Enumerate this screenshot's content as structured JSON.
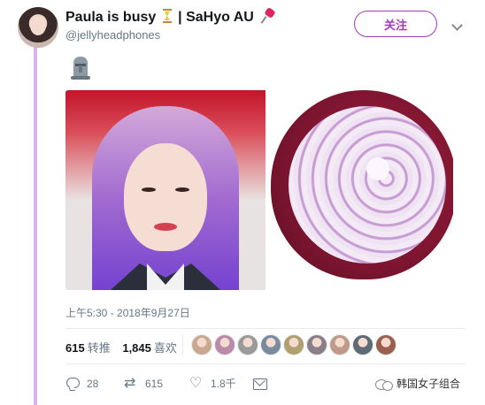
{
  "tweet": {
    "display_name_part1": "Paula is busy",
    "display_name_part2": "| SaHyo AU",
    "handle": "@jellyheadphones",
    "follow_label": "关注",
    "timestamp": "上午5:30 - 2018年9月27日",
    "retweets_count": "615",
    "retweets_label": "转推",
    "likes_count": "1,845",
    "likes_label": "喜欢",
    "icons": [
      "hourglass-icon",
      "pin-icon",
      "moai-icon",
      "reply-icon",
      "retweet-icon",
      "like-icon",
      "message-icon",
      "chevron-down-icon"
    ]
  },
  "likers": [
    {
      "color": "#caa88f"
    },
    {
      "color": "#b98ba8"
    },
    {
      "color": "#9a9a9a"
    },
    {
      "color": "#7a8aa0"
    },
    {
      "color": "#b0a070"
    },
    {
      "color": "#8a7f88"
    },
    {
      "color": "#c09a88"
    },
    {
      "color": "#5e6a74"
    },
    {
      "color": "#9b5f50"
    }
  ],
  "actions": {
    "reply_count": "28",
    "retweet_count": "615",
    "like_count": "1.8千"
  },
  "watermark": {
    "text": "韩国女子组合"
  },
  "colors": {
    "accent": "#a23bbf",
    "thread_line": "#d7b3f2",
    "muted": "#657786"
  }
}
